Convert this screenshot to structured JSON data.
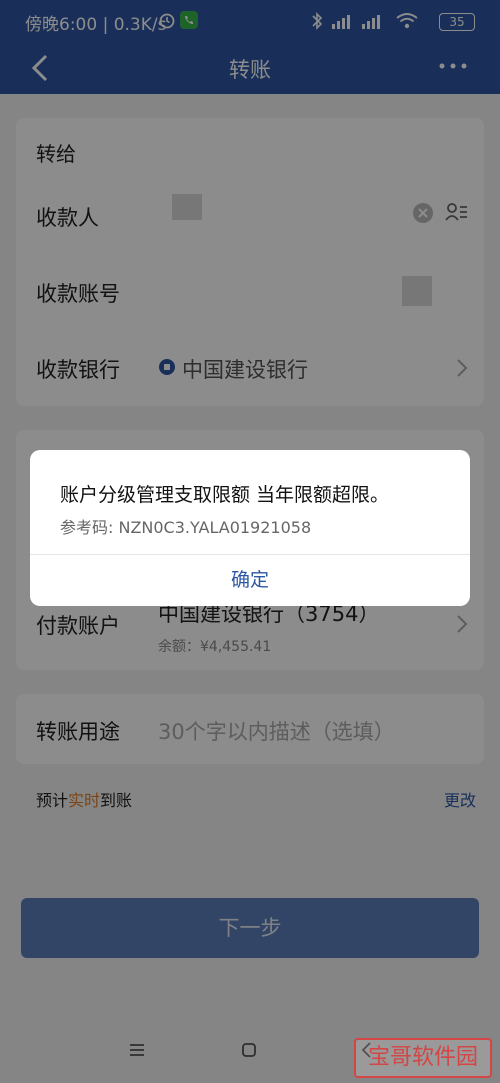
{
  "status_bar": {
    "time_speed": "傍晚6:00 | 0.3K/s",
    "battery": "35"
  },
  "nav": {
    "title": "转账"
  },
  "recipient": {
    "section_title": "转给",
    "payee_label": "收款人",
    "account_label": "收款账号",
    "bank_label": "收款银行",
    "bank_value": "中国建设银行"
  },
  "payer": {
    "account_label": "付款账户",
    "account_value": "中国建设银行（3754）",
    "balance": "余额：¥4,455.41"
  },
  "purpose": {
    "label": "转账用途",
    "placeholder": "30个字以内描述（选填）"
  },
  "arrival": {
    "prefix": "预计",
    "highlight": "实时",
    "suffix": "到账",
    "change": "更改"
  },
  "next_button": "下一步",
  "dialog": {
    "message": "账户分级管理支取限额 当年限额超限。",
    "reference": "参考码: NZN0C3.YALA01921058",
    "confirm": "确定"
  },
  "watermark": "宝哥软件园"
}
